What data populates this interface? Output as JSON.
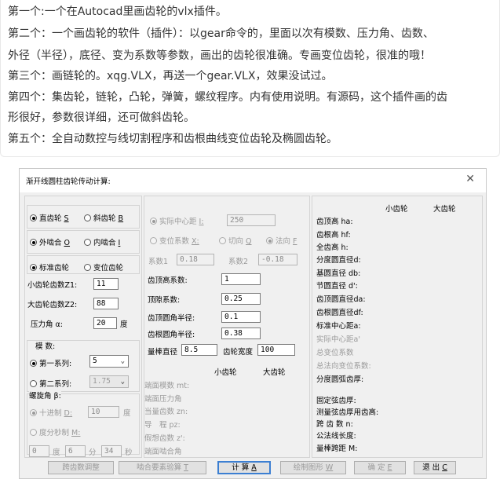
{
  "paragraphs": [
    "第一个:一个在Autocad里画齿轮的vlx插件。",
    "第二个：一个画齿轮的软件（插件）：以gear命令的，里面以次有模数、压力角、齿数、",
    "外径（半径），底径、变为系数等参数，画出的齿轮很准确。专画变位齿轮，很准的哦！",
    "第三个：画链轮的。xqg.VLX，再送一个gear.VLX，效果没试过。",
    "第四个：集齿轮，链轮，凸轮，弹簧，螺纹程序。内有使用说明。有源码，这个插件画的齿",
    "形很好，参数很详细，还可做斜齿轮。",
    "第五个：全自动数控与线切割程序和齿根曲线变位齿轮及椭圆齿轮。"
  ],
  "dialog": {
    "title": "渐开线圆柱齿轮传动计算:",
    "close": "✕",
    "gear_type": {
      "spur": "直齿轮",
      "spur_key": "S",
      "helical": "斜齿轮",
      "helical_key": "B"
    },
    "mesh_type": {
      "external": "外啮合",
      "external_key": "O",
      "internal": "内啮合",
      "internal_key": "I"
    },
    "gear_mode": {
      "standard": "标准齿轮",
      "modified": "变位齿轮"
    },
    "z1_label": "小齿轮齿数Z1:",
    "z1": "11",
    "z2_label": "大齿轮齿数Z2:",
    "z2": "88",
    "alpha_label": "压力角 α:",
    "alpha": "20",
    "alpha_unit": "度",
    "module_title": "模 数:",
    "series1": "第一系列:",
    "series1_value": "5",
    "series2": "第二系列:",
    "series2_value": "1.75",
    "beta_title": "螺旋角 β:",
    "decimal_label": "十进制",
    "decimal_key": "D:",
    "decimal_value": "10",
    "decimal_unit": "度",
    "dms_label": "度分秒制",
    "dms_key": "M:",
    "deg": "0",
    "deg_unit": "度",
    "min": "6",
    "min_unit": "分",
    "sec": "34",
    "sec_unit": "秒",
    "center_label": "实际中心距",
    "center_key": "I:",
    "center_value": "250",
    "shift_label": "变位系数",
    "shift_key": "X:",
    "tangent_label": "切向",
    "tangent_key": "Q",
    "normal_label": "法向",
    "normal_key": "F",
    "x1_label": "系数1",
    "x1": "0.18",
    "x2_label": "系数2",
    "x2": "-0.18",
    "addendum_coef_label": "齿顶高系数:",
    "addendum_coef": "1",
    "clearance_label": "顶隙系数:",
    "clearance": "0.25",
    "tip_radius_label": "齿顶圆角半径:",
    "tip_radius": "0.1",
    "root_radius_label": "齿根圆角半径:",
    "root_radius": "0.38",
    "pin_dia_label": "量棒直径",
    "pin_dia": "8.5",
    "face_width_label": "齿轮宽度",
    "face_width": "100",
    "small_gear": "小齿轮",
    "large_gear": "大齿轮",
    "disabled_params": [
      "端面模数 mt:",
      "端面压力角",
      "当量齿数 zn:",
      "导　程 pz:",
      "假想齿数 z':",
      "端面啮合角"
    ],
    "result_small": "小齿轮",
    "result_large": "大齿轮",
    "results": [
      "齿顶高 ha:",
      "齿根高 hf:",
      "全齿高 h:",
      "分度圆直径d:",
      "基圆直径 db:",
      "节圆直径 d':",
      "齿顶圆直径da:",
      "齿根圆直径df:",
      "标准中心距a:"
    ],
    "results_disabled": [
      "实际中心距a'",
      "总变位系数",
      "总法向变位系数:"
    ],
    "result_arc": "分度圆弧齿厚:",
    "results2": [
      "固定弦齿厚:",
      "测量弦齿厚用齿高:",
      "跨 齿 数 n:",
      "公法线长度:",
      "量棒跨距 M:"
    ],
    "buttons": {
      "adjust": "跨齿数调整",
      "check": "啮合要素验算",
      "check_key": "T",
      "calc": "计 算",
      "calc_key": "A",
      "draw": "绘制图形",
      "draw_key": "W",
      "ok": "确 定",
      "ok_key": "E",
      "exit": "退 出",
      "exit_key": "C"
    }
  }
}
